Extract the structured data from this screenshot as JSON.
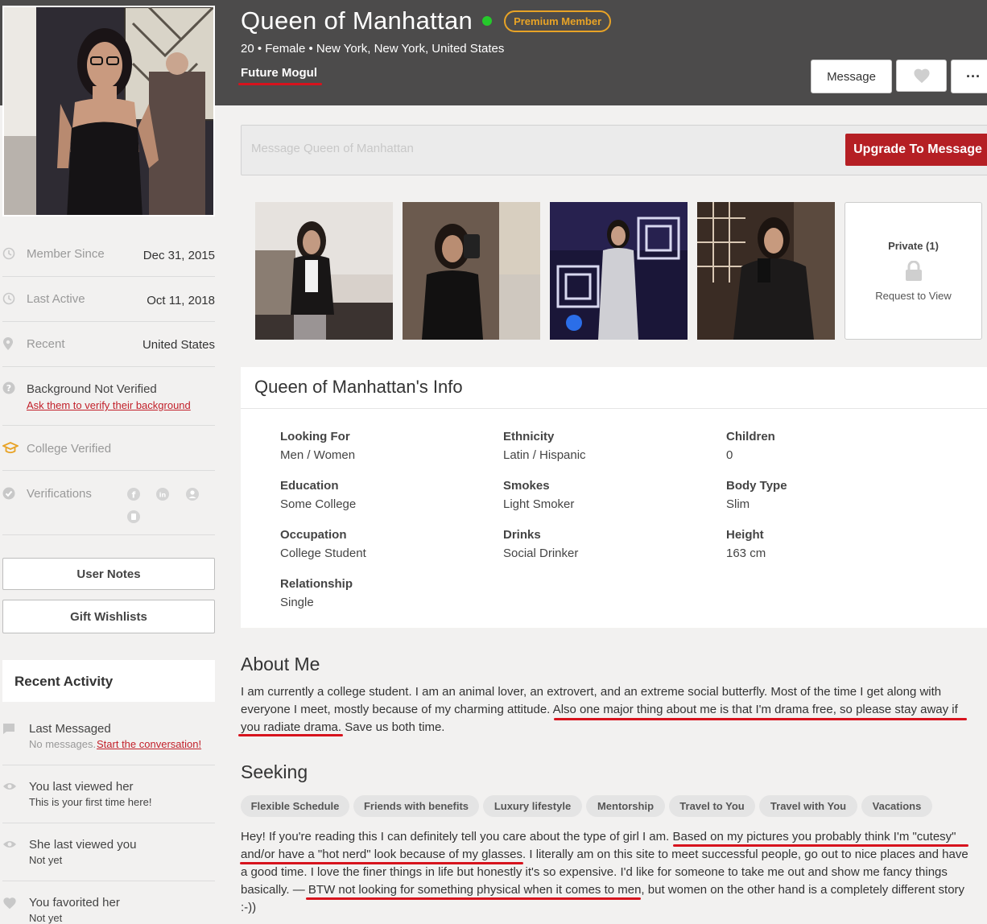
{
  "profile": {
    "name": "Queen of Manhattan",
    "badge": "Premium Member",
    "details": "20 • Female • New York, New York, United States",
    "tagline": "Future Mogul",
    "status_color": "#25c92b"
  },
  "actions": {
    "message_label": "Message",
    "favorite_icon": "heart-icon",
    "more_label": "···"
  },
  "message_bar": {
    "placeholder": "Message Queen of Manhattan",
    "upgrade_label": "Upgrade To Message"
  },
  "photos": {
    "private_title": "Private (1)",
    "private_action": "Request to View"
  },
  "sidebar": {
    "member_since_label": "Member Since",
    "member_since_value": "Dec 31, 2015",
    "last_active_label": "Last Active",
    "last_active_value": "Oct 11, 2018",
    "recent_label": "Recent",
    "recent_value": "United States",
    "background_label": "Background Not Verified",
    "background_link": "Ask them to verify their background",
    "college_label": "College Verified",
    "verifications_label": "Verifications",
    "user_notes": "User Notes",
    "gift_wishlists": "Gift Wishlists"
  },
  "recent_activity": {
    "title": "Recent Activity",
    "last_messaged_label": "Last Messaged",
    "last_messaged_sub": "No messages.",
    "last_messaged_link": "Start the conversation!",
    "you_viewed_label": "You last viewed her",
    "you_viewed_sub": "This is your first time here!",
    "she_viewed_label": "She last viewed you",
    "she_viewed_sub": "Not yet",
    "favorited_label": "You favorited her",
    "favorited_sub": "Not yet"
  },
  "info": {
    "title": "Queen of Manhattan's Info",
    "fields": [
      {
        "label": "Looking For",
        "value": "Men / Women"
      },
      {
        "label": "Ethnicity",
        "value": "Latin / Hispanic"
      },
      {
        "label": "Children",
        "value": "0"
      },
      {
        "label": "Education",
        "value": "Some College"
      },
      {
        "label": "Smokes",
        "value": "Light Smoker"
      },
      {
        "label": "Body Type",
        "value": "Slim"
      },
      {
        "label": "Occupation",
        "value": "College Student"
      },
      {
        "label": "Drinks",
        "value": "Social Drinker"
      },
      {
        "label": "Height",
        "value": "163 cm"
      },
      {
        "label": "Relationship",
        "value": "Single"
      }
    ]
  },
  "about": {
    "title": "About Me",
    "text": "I am currently a college student. I am an animal lover, an extrovert, and an extreme social butterfly. Most of the time I get along with everyone I meet, mostly because of my charming attitude. Also one major thing about me is that I'm drama free, so please stay away if you radiate drama. Save us both time."
  },
  "seeking": {
    "title": "Seeking",
    "tags": [
      "Flexible Schedule",
      "Friends with benefits",
      "Luxury lifestyle",
      "Mentorship",
      "Travel to You",
      "Travel with You",
      "Vacations"
    ],
    "text": "Hey! If you're reading this I can definitely tell you care about the type of girl I am. Based on my pictures you probably think I'm \"cutesy\" and/or have a \"hot nerd\" look because of my glasses. I literally am on this site to meet successful people, go out to nice places and have a good time. I love the finer things in life but honestly it's so expensive. I'd like for someone to take me out and show me fancy things basically. — BTW not looking for something physical when it comes to men, but women on the other hand is a completely different story :-))"
  },
  "colors": {
    "accent_red": "#b51f24",
    "premium_gold": "#e8a326",
    "header_bg": "#4c4b4b"
  }
}
